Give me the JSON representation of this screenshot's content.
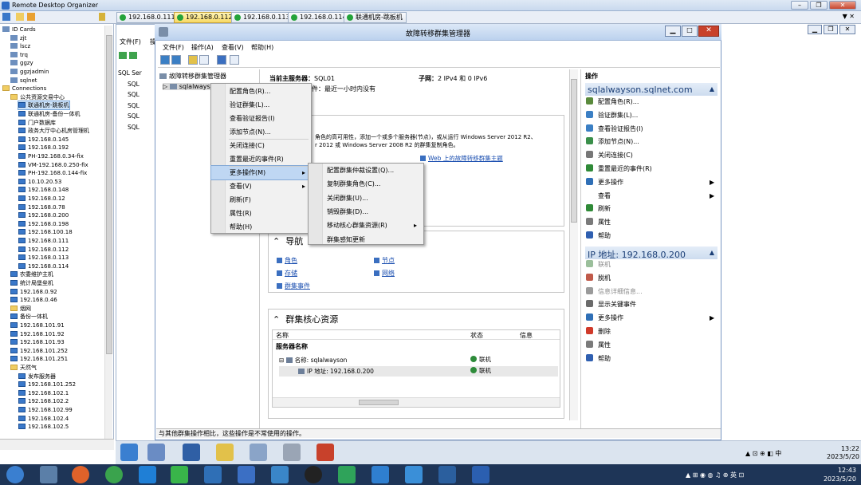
{
  "app": {
    "title": "Remote Desktop Organizer",
    "tray_clock": {
      "time": "12:43",
      "date": "2023/5/20"
    },
    "inner_clock": {
      "time": "13:22",
      "date": "2023/5/20"
    }
  },
  "tabs": [
    "192.168.0.111",
    "192.168.0.112",
    "192.168.0.113",
    "192.168.0.114",
    "联通机房-跳板机"
  ],
  "left_tree": [
    {
      "label": "ID Cards",
      "indent": 0,
      "icon": "id"
    },
    {
      "label": "zjt",
      "indent": 1,
      "icon": "id"
    },
    {
      "label": "lscz",
      "indent": 1,
      "icon": "id"
    },
    {
      "label": "trq",
      "indent": 1,
      "icon": "id"
    },
    {
      "label": "ggzy",
      "indent": 1,
      "icon": "id"
    },
    {
      "label": "ggzjadmin",
      "indent": 1,
      "icon": "id"
    },
    {
      "label": "sqlnet",
      "indent": 1,
      "icon": "id"
    },
    {
      "label": "Connections",
      "indent": 0,
      "icon": "fold"
    },
    {
      "label": "公共资源交易中心",
      "indent": 1,
      "icon": "fold"
    },
    {
      "label": "联通机房-跳板机",
      "indent": 2,
      "icon": "pc",
      "selected": true
    },
    {
      "label": "联通机房-备份一体机",
      "indent": 2,
      "icon": "pc"
    },
    {
      "label": "门户数据库",
      "indent": 2,
      "icon": "pc"
    },
    {
      "label": "政务大厅中心机房管理机",
      "indent": 2,
      "icon": "pc"
    },
    {
      "label": "192.168.0.145",
      "indent": 2,
      "icon": "pc"
    },
    {
      "label": "192.168.0.192",
      "indent": 2,
      "icon": "pc"
    },
    {
      "label": "PH-192.168.0.34-fix",
      "indent": 2,
      "icon": "pc"
    },
    {
      "label": "VM-192.168.0.250-fix",
      "indent": 2,
      "icon": "pc"
    },
    {
      "label": "PH-192.168.0.144-fix",
      "indent": 2,
      "icon": "pc"
    },
    {
      "label": "10.10.20.53",
      "indent": 2,
      "icon": "pc"
    },
    {
      "label": "192.168.0.148",
      "indent": 2,
      "icon": "pc"
    },
    {
      "label": "192.168.0.12",
      "indent": 2,
      "icon": "pc"
    },
    {
      "label": "192.168.0.78",
      "indent": 2,
      "icon": "pc"
    },
    {
      "label": "192.168.0.200",
      "indent": 2,
      "icon": "pc"
    },
    {
      "label": "192.168.0.198",
      "indent": 2,
      "icon": "pc"
    },
    {
      "label": "192.168.100.18",
      "indent": 2,
      "icon": "pc"
    },
    {
      "label": "192.168.0.111",
      "indent": 2,
      "icon": "pc"
    },
    {
      "label": "192.168.0.112",
      "indent": 2,
      "icon": "pc"
    },
    {
      "label": "192.168.0.113",
      "indent": 2,
      "icon": "pc"
    },
    {
      "label": "192.168.0.114",
      "indent": 2,
      "icon": "pc"
    },
    {
      "label": "农委维护主机",
      "indent": 1,
      "icon": "pc"
    },
    {
      "label": "统计局堡垒机",
      "indent": 1,
      "icon": "pc"
    },
    {
      "label": "192.168.0.92",
      "indent": 1,
      "icon": "pc"
    },
    {
      "label": "192.168.0.46",
      "indent": 1,
      "icon": "pc"
    },
    {
      "label": "烟网",
      "indent": 1,
      "icon": "fold"
    },
    {
      "label": "备份一体机",
      "indent": 1,
      "icon": "pc"
    },
    {
      "label": "192.168.101.91",
      "indent": 1,
      "icon": "pc"
    },
    {
      "label": "192.168.101.92",
      "indent": 1,
      "icon": "pc"
    },
    {
      "label": "192.168.101.93",
      "indent": 1,
      "icon": "pc"
    },
    {
      "label": "192.168.101.252",
      "indent": 1,
      "icon": "pc"
    },
    {
      "label": "192.168.101.251",
      "indent": 1,
      "icon": "pc"
    },
    {
      "label": "天然气",
      "indent": 1,
      "icon": "fold"
    },
    {
      "label": "发布服务器",
      "indent": 2,
      "icon": "pc"
    },
    {
      "label": "192.168.101.252",
      "indent": 2,
      "icon": "pc"
    },
    {
      "label": "192.168.102.1",
      "indent": 2,
      "icon": "pc"
    },
    {
      "label": "192.168.102.2",
      "indent": 2,
      "icon": "pc"
    },
    {
      "label": "192.168.102.99",
      "indent": 2,
      "icon": "pc"
    },
    {
      "label": "192.168.102.4",
      "indent": 2,
      "icon": "pc"
    },
    {
      "label": "192.168.102.5",
      "indent": 2,
      "icon": "pc"
    }
  ],
  "bgwin": {
    "menu_file": "文件(F)",
    "menu_trunc": "操",
    "tree": [
      "SQL Ser",
      "SQL",
      "SQL",
      "SQL",
      "SQL",
      "SQL"
    ]
  },
  "fcm": {
    "title": "故障转移群集管理器",
    "menus": [
      "文件(F)",
      "操作(A)",
      "查看(V)",
      "帮助(H)"
    ],
    "tree_root": "故障转移群集管理器",
    "tree_child": "sqlalwayso",
    "summary": {
      "server_label": "当前主服务器：",
      "server": "SQL01",
      "subnet_label": "子网：",
      "subnet": "2 IPv4 和 0 IPv6",
      "events_frag": "件：最近一小时内没有"
    },
    "desc1": "角色的高可用性，添加一个或多个服务器(节点)，或从运行 Windows Server 2012 R2、",
    "desc2": "r 2012 或 Windows Server 2008 R2 的群集复制角色。",
    "web_link": "Web 上的故障转移群集主题",
    "nav_title": "导航",
    "nav_links": [
      "角色",
      "节点",
      "存储",
      "网络",
      "群集事件"
    ],
    "core_title": "群集核心资源",
    "table": {
      "headers": [
        "名称",
        "状态",
        "信息"
      ],
      "group": "服务器名称",
      "rows": [
        {
          "name": "名称: sqlalwayson",
          "status": "联机"
        },
        {
          "name": "IP 地址: 192.168.0.200",
          "status": "联机"
        }
      ]
    },
    "status_text": "与其他群集操作相比，这些操作是不常使用的操作。"
  },
  "actions": {
    "header": "操作",
    "section1": "sqlalwayson.sqlnet.com",
    "items1": [
      {
        "label": "配置角色(R)...",
        "icon": "#5a8a3c"
      },
      {
        "label": "验证群集(L)...",
        "icon": "#3b7fc4"
      },
      {
        "label": "查看验证报告(I)",
        "icon": "#3b7fc4"
      },
      {
        "label": "添加节点(N)...",
        "icon": "#3a8f4a"
      },
      {
        "label": "关闭连接(C)",
        "icon": "#777777"
      },
      {
        "label": "重置最近的事件(R)",
        "icon": "#2f8a37"
      },
      {
        "label": "更多操作",
        "icon": "#2f6fb6",
        "arrow": true
      },
      {
        "label": "查看",
        "icon": "",
        "arrow": true
      },
      {
        "label": "刷新",
        "icon": "#2f8a37"
      },
      {
        "label": "属性",
        "icon": "#7a7a7a"
      },
      {
        "label": "帮助",
        "icon": "#2f5fb0"
      }
    ],
    "section2": "IP 地址: 192.168.0.200",
    "items2": [
      {
        "label": "联机",
        "icon": "#9bbf9b",
        "dim": true
      },
      {
        "label": "脱机",
        "icon": "#c05a4a"
      },
      {
        "label": "信息详细信息...",
        "icon": "#9a9a9a",
        "dim": true
      },
      {
        "label": "显示关键事件",
        "icon": "#6a6a6a"
      },
      {
        "label": "更多操作",
        "icon": "#2f6fb6",
        "arrow": true
      },
      {
        "label": "删除",
        "icon": "#d03a2a"
      },
      {
        "label": "属性",
        "icon": "#7a7a7a"
      },
      {
        "label": "帮助",
        "icon": "#2f5fb0"
      }
    ]
  },
  "context_menu": [
    "配置角色(R)...",
    "验证群集(L)...",
    "查看验证报告(I)",
    "添加节点(N)...",
    "关闭连接(C)",
    "重置最近的事件(R)",
    "更多操作(M)",
    "查看(V)",
    "刷新(F)",
    "属性(R)",
    "帮助(H)"
  ],
  "submenu": [
    "配置群集仲裁设置(Q)...",
    "复制群集角色(C)...",
    "关闭群集(U)...",
    "销毁群集(D)...",
    "移动核心群集资源(R)",
    "群集感知更新"
  ],
  "colors": {
    "accent": "#2d6bc4",
    "selected_tab": "#f7d862",
    "online": "#2e8b3a"
  }
}
